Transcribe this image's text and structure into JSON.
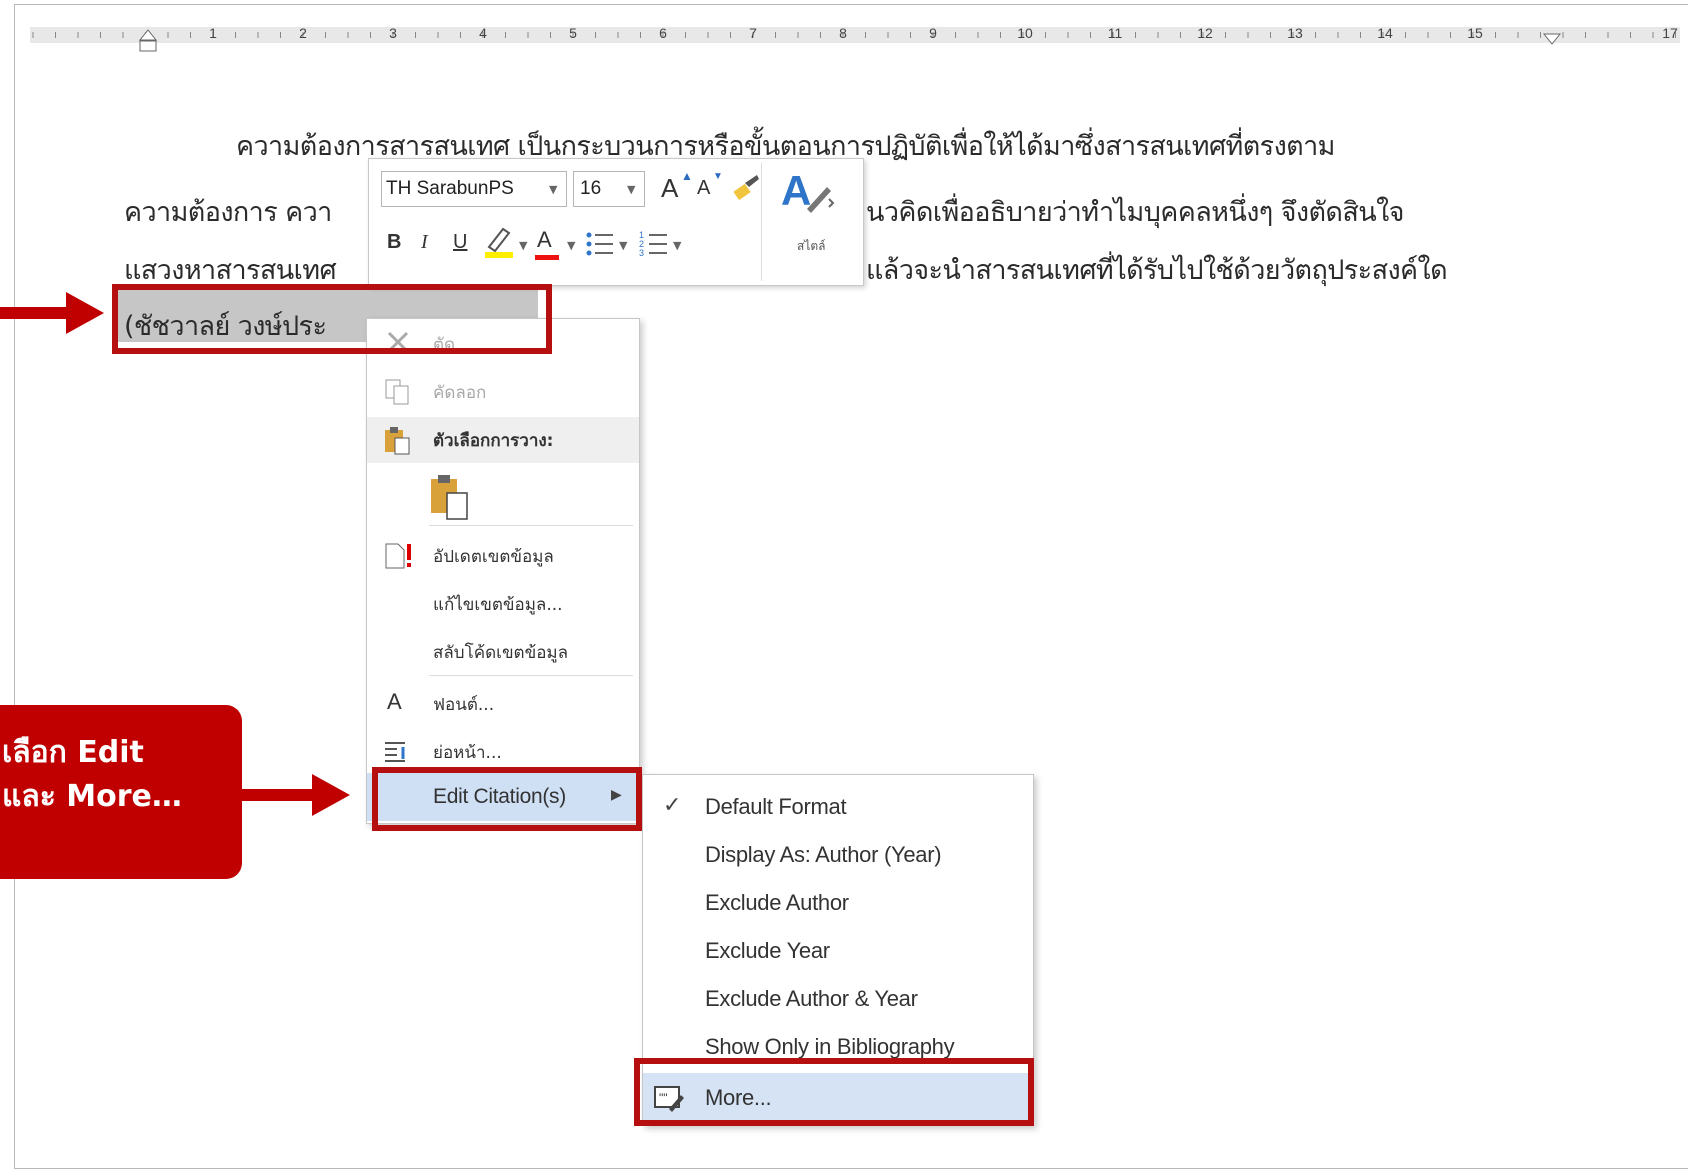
{
  "ruler": {
    "numbers": [
      "1",
      "2",
      "3",
      "4",
      "5",
      "6",
      "7",
      "8",
      "9",
      "10",
      "11",
      "12",
      "13",
      "14",
      "15",
      "17"
    ]
  },
  "document": {
    "line1": "ความต้องการสารสนเทศ เป็นกระบวนการหรือขั้นตอนการปฏิบัติเพื่อให้ได้มาซึ่งสารสนเทศที่ตรงตาม",
    "line2_left": "ความต้องการ ควา",
    "line2_right": "นวคิดเพื่ออธิบายว่าทำไมบุคคลหนึ่งๆ จึงตัดสินใจ",
    "line3_left": "แสวงหาสารสนเทศ",
    "line3_right": "แล้วจะนำสารสนเทศที่ได้รับไปใช้ด้วยวัตถุประสงค์ใด",
    "citation_visible": "(ชัชวาลย์ วงษ์ประ"
  },
  "mini_toolbar": {
    "font_name": "TH SarabunPS",
    "font_size": "16",
    "grow_font": "A",
    "shrink_font": "A",
    "bold": "B",
    "italic": "I",
    "underline": "U",
    "font_color": "A",
    "styles_label": "สไตล์"
  },
  "context_menu": {
    "cut": "ตัด",
    "copy": "คัดลอก",
    "paste_options": "ตัวเลือกการวาง:",
    "update_field": "อัปเดตเขตข้อมูล",
    "edit_field": "แก้ไขเขตข้อมูล...",
    "toggle_field_codes": "สลับโค้ดเขตข้อมูล",
    "font": "ฟอนต์...",
    "paragraph": "ย่อหน้า...",
    "font_icon": "A",
    "edit_citations": "Edit Citation(s)"
  },
  "sub_menu": {
    "items": [
      {
        "label": "Default Format",
        "checked": true
      },
      {
        "label": "Display As: Author (Year)",
        "checked": false
      },
      {
        "label": "Exclude Author",
        "checked": false
      },
      {
        "label": "Exclude Year",
        "checked": false
      },
      {
        "label": "Exclude Author & Year",
        "checked": false
      },
      {
        "label": "Show Only in Bibliography",
        "checked": false
      }
    ],
    "more": "More...",
    "check_mark": "✓"
  },
  "callout": {
    "line1": "เลือก Edit",
    "line2": "และ More…"
  },
  "colors": {
    "annotation_red": "#b50f0f",
    "callout_bg": "#c00000",
    "highlight_gray": "#c6c6c6",
    "menu_highlight": "#cfe0f5"
  }
}
